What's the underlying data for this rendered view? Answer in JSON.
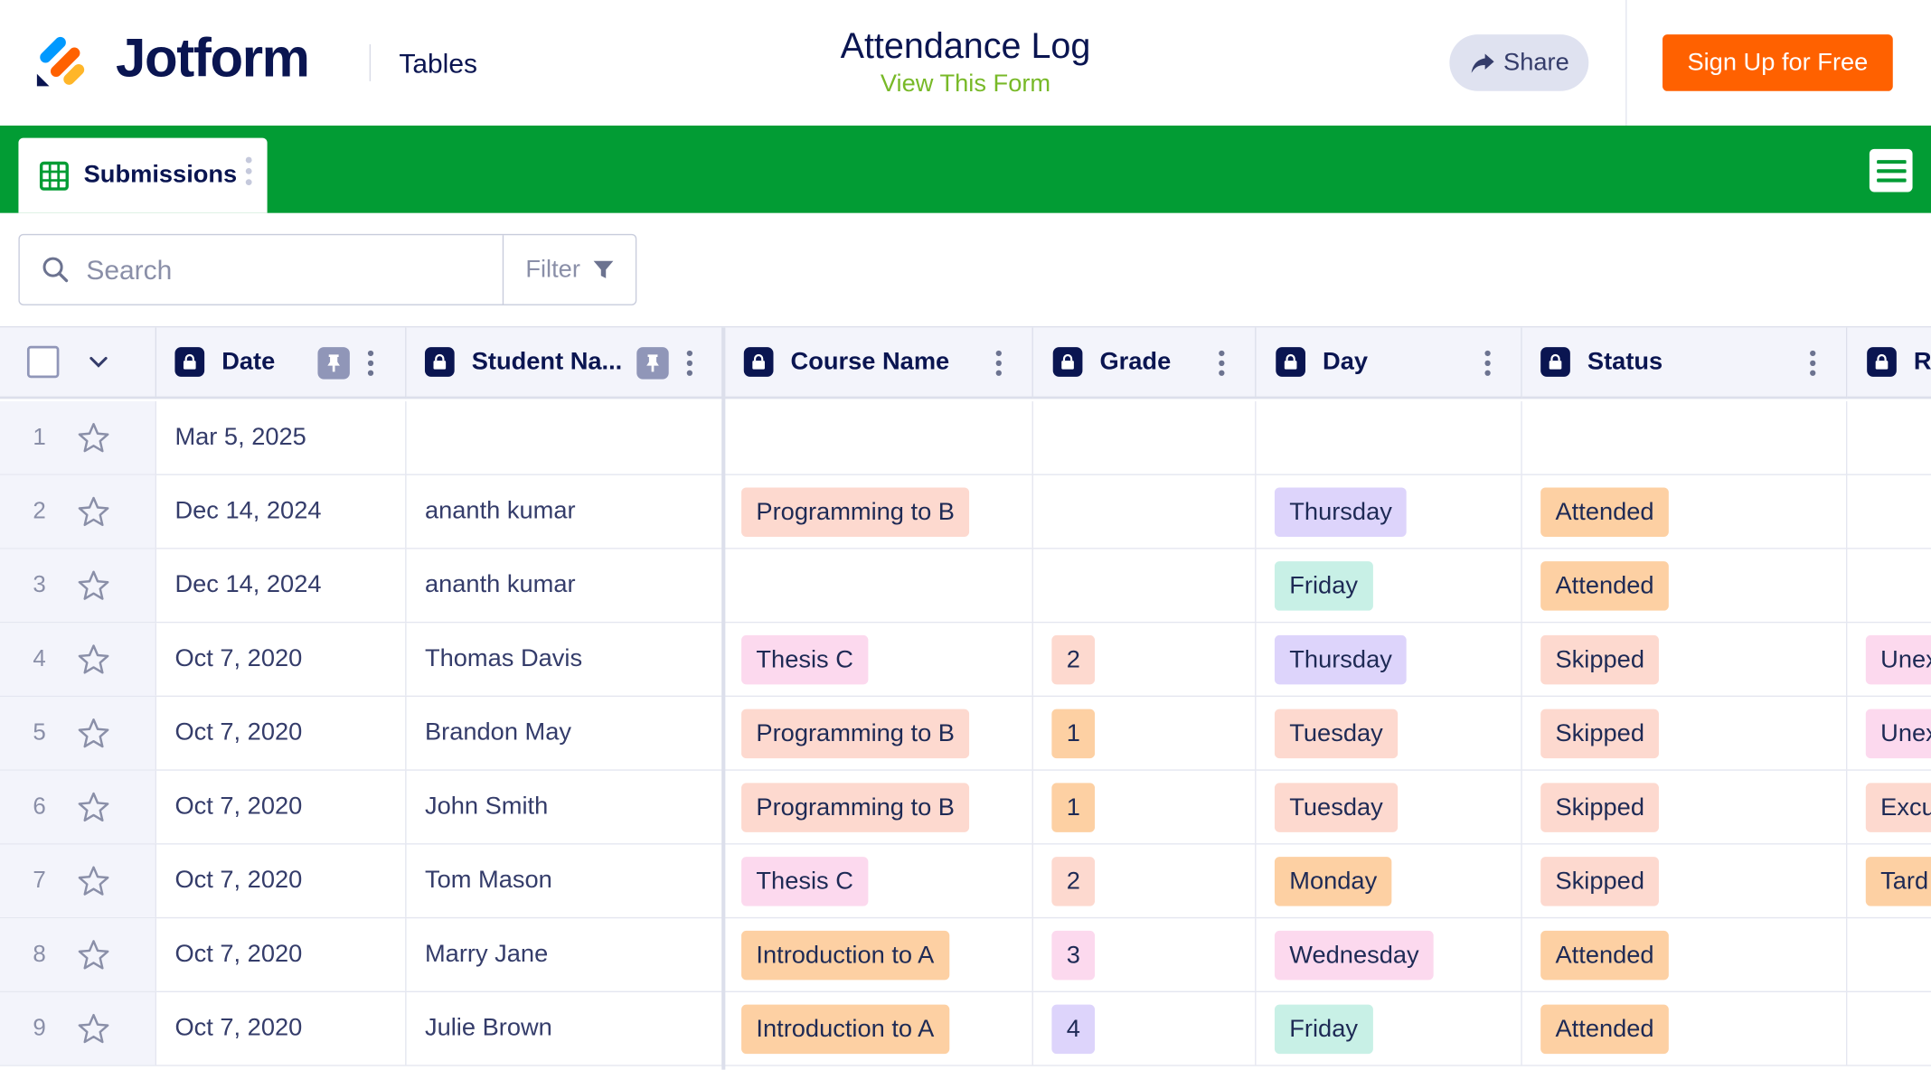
{
  "header": {
    "brand": "Jotform",
    "section": "Tables",
    "title": "Attendance Log",
    "view_form": "View This Form",
    "share_label": "Share",
    "signup_label": "Sign Up for Free"
  },
  "tabs": [
    {
      "label": "Submissions"
    }
  ],
  "search": {
    "placeholder": "Search",
    "filter_label": "Filter"
  },
  "columns": [
    "Date",
    "Student Na...",
    "Course Name",
    "Grade",
    "Day",
    "Status",
    "R"
  ],
  "rows": [
    {
      "num": "1",
      "date": "Mar 5, 2025",
      "student": "",
      "course": "",
      "grade": "",
      "day": "",
      "status": "",
      "reason": ""
    },
    {
      "num": "2",
      "date": "Dec 14, 2024",
      "student": "ananth kumar",
      "course": "Programming to B",
      "grade": "",
      "day": "Thursday",
      "status": "Attended",
      "reason": ""
    },
    {
      "num": "3",
      "date": "Dec 14, 2024",
      "student": "ananth kumar",
      "course": "",
      "grade": "",
      "day": "Friday",
      "status": "Attended",
      "reason": ""
    },
    {
      "num": "4",
      "date": "Oct 7, 2020",
      "student": "Thomas Davis",
      "course": "Thesis C",
      "grade": "2",
      "day": "Thursday",
      "status": "Skipped",
      "reason": "Unex"
    },
    {
      "num": "5",
      "date": "Oct 7, 2020",
      "student": "Brandon May",
      "course": "Programming to B",
      "grade": "1",
      "day": "Tuesday",
      "status": "Skipped",
      "reason": "Unex"
    },
    {
      "num": "6",
      "date": "Oct 7, 2020",
      "student": "John Smith",
      "course": "Programming to B",
      "grade": "1",
      "day": "Tuesday",
      "status": "Skipped",
      "reason": "Excu"
    },
    {
      "num": "7",
      "date": "Oct 7, 2020",
      "student": "Tom Mason",
      "course": "Thesis C",
      "grade": "2",
      "day": "Monday",
      "status": "Skipped",
      "reason": "Tard"
    },
    {
      "num": "8",
      "date": "Oct 7, 2020",
      "student": "Marry Jane",
      "course": "Introduction to A",
      "grade": "3",
      "day": "Wednesday",
      "status": "Attended",
      "reason": ""
    },
    {
      "num": "9",
      "date": "Oct 7, 2020",
      "student": "Julie Brown",
      "course": "Introduction to A",
      "grade": "4",
      "day": "Friday",
      "status": "Attended",
      "reason": ""
    }
  ],
  "tag_colors": {
    "course": {
      "Programming to B": "#fdd9cf",
      "Thesis C": "#fcd9ee",
      "Introduction to A": "#fdd0a3"
    },
    "grade": {
      "1": "#fdd0a3",
      "2": "#fdd9cf",
      "3": "#fcd9ee",
      "4": "#ddd4fb"
    },
    "day": {
      "Monday": "#fdd0a3",
      "Tuesday": "#fdd9cf",
      "Wednesday": "#fcd9ee",
      "Thursday": "#ddd4fb",
      "Friday": "#c8f0e6"
    },
    "status": {
      "Attended": "#fdd0a3",
      "Skipped": "#fdd9cf"
    },
    "reason": {
      "Unex": "#fcd9ee",
      "Excu": "#fdd9cf",
      "Tard": "#fdd0a3"
    }
  },
  "colors": {
    "accent_green": "#029c34",
    "signup_orange": "#ff6100",
    "navy": "#0a1551",
    "link_green": "#78b928"
  },
  "icons": [
    "jotform-logo-icon",
    "table-grid-icon",
    "share-arrow-icon",
    "menu-icon",
    "search-icon",
    "filter-icon",
    "lock-icon",
    "pin-icon",
    "star-icon",
    "chevron-down-icon",
    "more-dots-icon"
  ]
}
